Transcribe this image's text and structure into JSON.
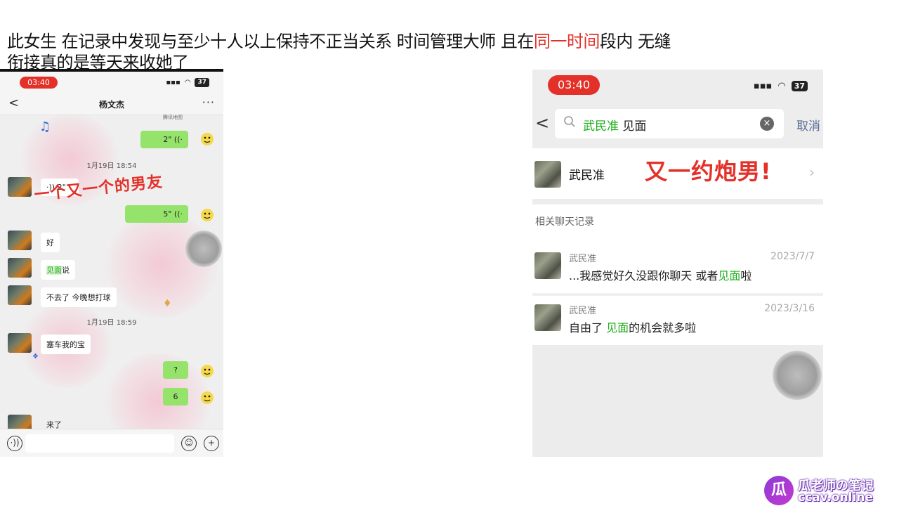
{
  "caption": {
    "line1_a": "此女生 在记录中发现与至少十人以上保持不正当关系 时间管理大师 且在",
    "line1_red": "同一时间",
    "line1_b": "段内 无缝",
    "line2": "衔接真的是等天来收她了"
  },
  "left_phone": {
    "status_time": "03:40",
    "battery": "37",
    "chat_title": "杨文杰",
    "back": "<",
    "more": "···",
    "top_label": "腾讯地图",
    "messages": {
      "voice_out_1": "2\" ((·",
      "time_1": "1月19日 18:54",
      "voice_in_1": "·)) 2\"",
      "voice_out_2": "5\" ((·",
      "text_in_1": "好",
      "text_in_2_green": "见面",
      "text_in_2_rest": "说",
      "text_in_3": "不去了  今晚想打球",
      "time_2": "1月19日 18:59",
      "text_in_4": "塞车我的宝",
      "text_out_1": "?",
      "text_out_2": "6",
      "text_in_5": "来了"
    },
    "stamp": "一个又一个的男友",
    "input_icons": {
      "voice": "·))",
      "emoji": "☺",
      "plus": "+"
    }
  },
  "right_phone": {
    "status_time": "03:40",
    "battery": "37",
    "search": {
      "green": "武民准",
      "rest": " 见面",
      "cancel": "取消"
    },
    "contact": {
      "name": "武民准",
      "stamp": "又一约炮男!"
    },
    "section_title": "相关聊天记录",
    "records": [
      {
        "name": "武民准",
        "date": "2023/7/7",
        "text_a": "...我感觉好久没跟你聊天  或者",
        "text_green": "见面",
        "text_b": "啦"
      },
      {
        "name": "武民准",
        "date": "2023/3/16",
        "text_a": "自由了  ",
        "text_green": "见面",
        "text_b": "的机会就多啦"
      }
    ]
  },
  "watermark": {
    "line1": "瓜老师の笔记",
    "line2": "ccav.online",
    "logo": "瓜"
  }
}
